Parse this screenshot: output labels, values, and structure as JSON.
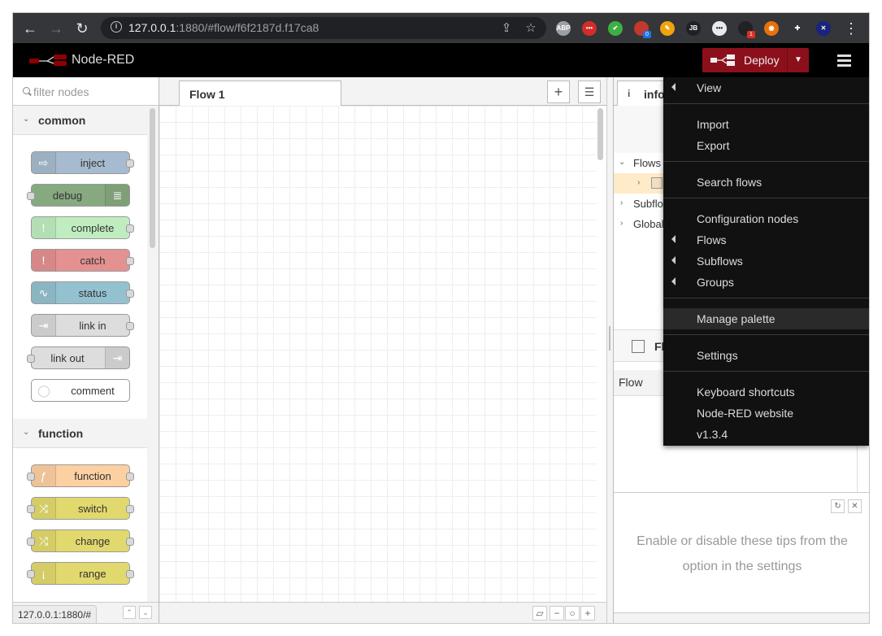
{
  "browser": {
    "url_host": "127.0.0.1",
    "url_rest": ":1880/#flow/f6f2187d.f17ca8",
    "status_url": "127.0.0.1:1880/#",
    "extensions": [
      {
        "name": "adblock-extension-icon",
        "text": "ABP",
        "color": "#9aa0a6"
      },
      {
        "name": "lastpass-extension-icon",
        "text": "•••",
        "color": "#d32d27"
      },
      {
        "name": "check-extension-icon",
        "text": "✔",
        "color": "#3cb043"
      },
      {
        "name": "red-extension-icon",
        "text": "",
        "color": "#c0392b",
        "badge": "0",
        "badge_color": "#1a73e8"
      },
      {
        "name": "orange-pen-extension-icon",
        "text": "✎",
        "color": "#f0a30a"
      },
      {
        "name": "jb-extension-icon",
        "text": "JB",
        "color": "#202124"
      },
      {
        "name": "dots-extension-icon",
        "text": "•••",
        "color": "#e8eaed"
      },
      {
        "name": "camera-extension-icon",
        "text": "",
        "color": "#202124",
        "badge": "1",
        "badge_color": "#d93025"
      },
      {
        "name": "orange-circle-extension-icon",
        "text": "◉",
        "color": "#e8710a"
      },
      {
        "name": "puzzle-extension-icon",
        "text": "✚",
        "color": "#35363a"
      },
      {
        "name": "x-extension-icon",
        "text": "✕",
        "color": "#1a237e"
      }
    ]
  },
  "header": {
    "title": "Node-RED",
    "deploy_label": "Deploy"
  },
  "palette": {
    "search_placeholder": "filter nodes",
    "categories": [
      {
        "label": "common"
      },
      {
        "label": "function"
      }
    ],
    "common_nodes": [
      {
        "label": "inject",
        "color": "#a6bbcf",
        "icon": "⇨"
      },
      {
        "label": "debug",
        "color": "#87a980",
        "icon": "≣"
      },
      {
        "label": "complete",
        "color": "#c0edc0",
        "icon": "!"
      },
      {
        "label": "catch",
        "color": "#e49191",
        "icon": "!"
      },
      {
        "label": "status",
        "color": "#94c1d0",
        "icon": "∿"
      },
      {
        "label": "link in",
        "color": "#dddddd",
        "icon": "⇥"
      },
      {
        "label": "link out",
        "color": "#dddddd",
        "icon": "⇥"
      },
      {
        "label": "comment",
        "color": "#ffffff",
        "icon": "◯"
      }
    ],
    "function_nodes": [
      {
        "label": "function",
        "color": "#fdd0a2",
        "icon": "ƒ"
      },
      {
        "label": "switch",
        "color": "#e2d96e",
        "icon": "⤨"
      },
      {
        "label": "change",
        "color": "#e2d96e",
        "icon": "⤮"
      },
      {
        "label": "range",
        "color": "#e2d96e",
        "icon": "¡"
      }
    ]
  },
  "workspace": {
    "tab_label": "Flow 1"
  },
  "sidebar": {
    "tab_label": "info",
    "tree": [
      {
        "label": "Flows"
      },
      {
        "label": "Subflo"
      },
      {
        "label": "Global"
      }
    ],
    "section_label": "Fl",
    "prop_label": "Flow",
    "tip_text": "Enable or disable these tips from the option in the settings"
  },
  "menu": {
    "view": "View",
    "import": "Import",
    "export": "Export",
    "search_flows": "Search flows",
    "configuration_nodes": "Configuration nodes",
    "flows": "Flows",
    "subflows": "Subflows",
    "groups": "Groups",
    "manage_palette": "Manage palette",
    "settings": "Settings",
    "keyboard_shortcuts": "Keyboard shortcuts",
    "website": "Node-RED website",
    "version": "v1.3.4"
  }
}
